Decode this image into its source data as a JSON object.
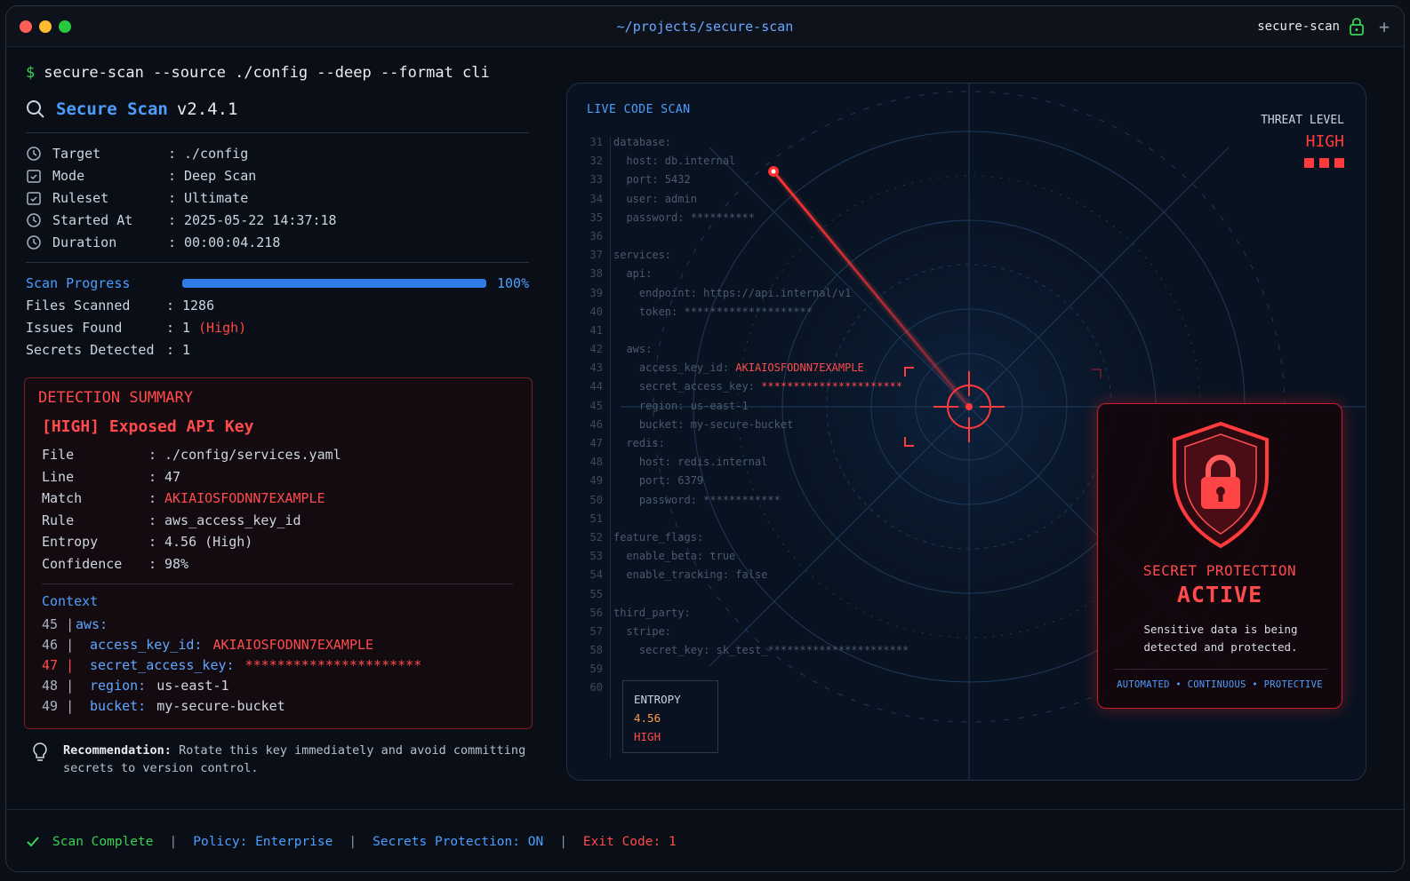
{
  "window": {
    "path": "~/projects/secure-scan",
    "app": "secure-scan"
  },
  "command": {
    "prompt": "$",
    "text": "secure-scan --source ./config --deep --format cli"
  },
  "app": {
    "name": "Secure Scan",
    "version": "v2.4.1"
  },
  "info": [
    {
      "icon": "target-icon",
      "key": "Target",
      "value": "./config"
    },
    {
      "icon": "mode-icon",
      "key": "Mode",
      "value": "Deep Scan"
    },
    {
      "icon": "ruleset-icon",
      "key": "Ruleset",
      "value": "Ultimate"
    },
    {
      "icon": "clock-icon",
      "key": "Started At",
      "value": "2025-05-22 14:37:18"
    },
    {
      "icon": "timer-icon",
      "key": "Duration",
      "value": "00:00:04.218"
    }
  ],
  "progress": {
    "label": "Scan Progress",
    "percent": 100,
    "percent_text": "100%"
  },
  "stats": {
    "files_label": "Files Scanned",
    "files_value": "1286",
    "issues_label": "Issues Found",
    "issues_value": "1",
    "issues_severity": "(High)",
    "secrets_label": "Secrets Detected",
    "secrets_value": "1"
  },
  "detection": {
    "header": "DETECTION SUMMARY",
    "issue": "[HIGH] Exposed API Key",
    "fields": [
      {
        "key": "File",
        "value": "./config/services.yaml"
      },
      {
        "key": "Line",
        "value": "47"
      },
      {
        "key": "Match",
        "value": "AKIAIOSFODNN7EXAMPLE"
      },
      {
        "key": "Rule",
        "value": "aws_access_key_id"
      },
      {
        "key": "Entropy",
        "value": "4.56 (High)"
      },
      {
        "key": "Confidence",
        "value": "98%"
      }
    ],
    "context_title": "Context",
    "context": [
      {
        "ln": "45 |",
        "key": "aws:",
        "val": ""
      },
      {
        "ln": "46 |",
        "key": "access_key_id:",
        "val": "AKIAIOSFODNN7EXAMPLE"
      },
      {
        "ln": "47 |",
        "key": "secret_access_key:",
        "val": "**********************"
      },
      {
        "ln": "48 |",
        "key": "region:",
        "val": "us-east-1"
      },
      {
        "ln": "49 |",
        "key": "bucket:",
        "val": "my-secure-bucket"
      }
    ]
  },
  "recommendation": {
    "label": "Recommendation:",
    "text": "Rotate this key immediately and avoid committing secrets to version control."
  },
  "statusbar": {
    "complete": "Scan Complete",
    "policy_label": "Policy:",
    "policy_value": "Enterprise",
    "protection": "Secrets Protection: ON",
    "exit": "Exit Code: 1"
  },
  "scan": {
    "title": "LIVE CODE SCAN",
    "threat_label": "THREAT LEVEL",
    "threat_value": "HIGH",
    "code": [
      {
        "n": "31",
        "t": "database:"
      },
      {
        "n": "32",
        "t": "  host: db.internal"
      },
      {
        "n": "33",
        "t": "  port: 5432"
      },
      {
        "n": "34",
        "t": "  user: admin"
      },
      {
        "n": "35",
        "t": "  password: **********"
      },
      {
        "n": "36",
        "t": ""
      },
      {
        "n": "37",
        "t": "services:"
      },
      {
        "n": "38",
        "t": "  api:"
      },
      {
        "n": "39",
        "t": "    endpoint: https://api.internal/v1"
      },
      {
        "n": "40",
        "t": "    token: ********************"
      },
      {
        "n": "41",
        "t": ""
      },
      {
        "n": "42",
        "t": "  aws:"
      },
      {
        "n": "43",
        "t": "    access_key_id: ",
        "red": "AKIAIOSFODNN7EXAMPLE"
      },
      {
        "n": "44",
        "t": "    secret_access_key: ",
        "red": "**********************"
      },
      {
        "n": "45",
        "t": "    region: us-east-1"
      },
      {
        "n": "46",
        "t": "    bucket: my-secure-bucket"
      },
      {
        "n": "47",
        "t": "  redis:"
      },
      {
        "n": "48",
        "t": "    host: redis.internal"
      },
      {
        "n": "49",
        "t": "    port: 6379"
      },
      {
        "n": "50",
        "t": "    password: ************"
      },
      {
        "n": "51",
        "t": ""
      },
      {
        "n": "52",
        "t": "feature_flags:"
      },
      {
        "n": "53",
        "t": "  enable_beta: true"
      },
      {
        "n": "54",
        "t": "  enable_tracking: false"
      },
      {
        "n": "55",
        "t": ""
      },
      {
        "n": "56",
        "t": "third_party:"
      },
      {
        "n": "57",
        "t": "  stripe:"
      },
      {
        "n": "58",
        "t": "    secret_key: sk_test_**********************"
      },
      {
        "n": "59",
        "t": ""
      },
      {
        "n": "60",
        "t": ""
      }
    ],
    "entropy_label": "ENTROPY",
    "entropy_value": "4.56",
    "entropy_level": "HIGH"
  },
  "protection": {
    "title": "SECRET PROTECTION",
    "status": "ACTIVE",
    "desc": "Sensitive data is being detected and protected.",
    "tags": "AUTOMATED • CONTINUOUS • PROTECTIVE"
  },
  "colors": {
    "accent": "#4d9fff",
    "danger": "#ff4b4b",
    "ok": "#39d353"
  }
}
